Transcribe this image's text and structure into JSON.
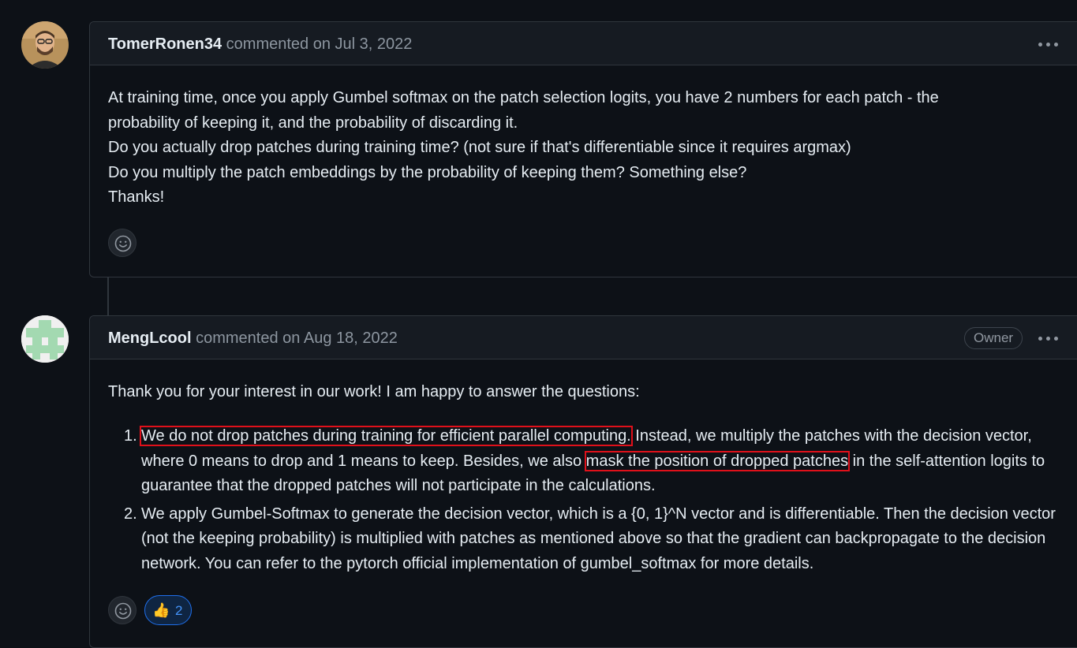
{
  "comment1": {
    "author": "TomerRonen34",
    "meta": "commented on Jul 3, 2022",
    "lines": [
      "At training time, once you apply Gumbel softmax on the patch selection logits, you have 2 numbers for each patch - the",
      "probability of keeping it, and the probability of discarding it.",
      "Do you actually drop patches during training time? (not sure if that's differentiable since it requires argmax)",
      "Do you multiply the patch embeddings by the probability of keeping them? Something else?",
      "Thanks!"
    ]
  },
  "comment2": {
    "author": "MengLcool",
    "meta": "commented on Aug 18, 2022",
    "badge": "Owner",
    "intro": "Thank you for your interest in our work! I am happy to answer the questions:",
    "item1": {
      "num": "1.",
      "highlight_a": "We do not drop patches during training for efficient parallel computing.",
      "text_b": " Instead, we multiply the patches with the decision vector, where 0 means to drop and 1 means to keep. Besides, we also ",
      "highlight_c": "mask the position of dropped patches",
      "text_d": " in the self-attention logits to guarantee that the dropped patches will not participate in the calculations."
    },
    "item2": {
      "num": "2.",
      "text": "We apply Gumbel-Softmax to generate the decision vector, which is a {0, 1}^N vector and is differentiable. Then the decision vector (not the keeping probability) is multiplied with patches as mentioned above so that the gradient can backpropagate to the decision network. You can refer to the pytorch official implementation of gumbel_softmax for more details."
    },
    "reaction": {
      "emoji": "👍",
      "count": "2"
    }
  },
  "icons": {
    "emoji_button": "smiley-icon",
    "menu": "kebab-horizontal-icon"
  },
  "colors": {
    "background": "#0d1117",
    "header": "#161b22",
    "border": "#30363d",
    "highlight_box": "#e0101a",
    "reaction_accent": "#4493f8"
  }
}
